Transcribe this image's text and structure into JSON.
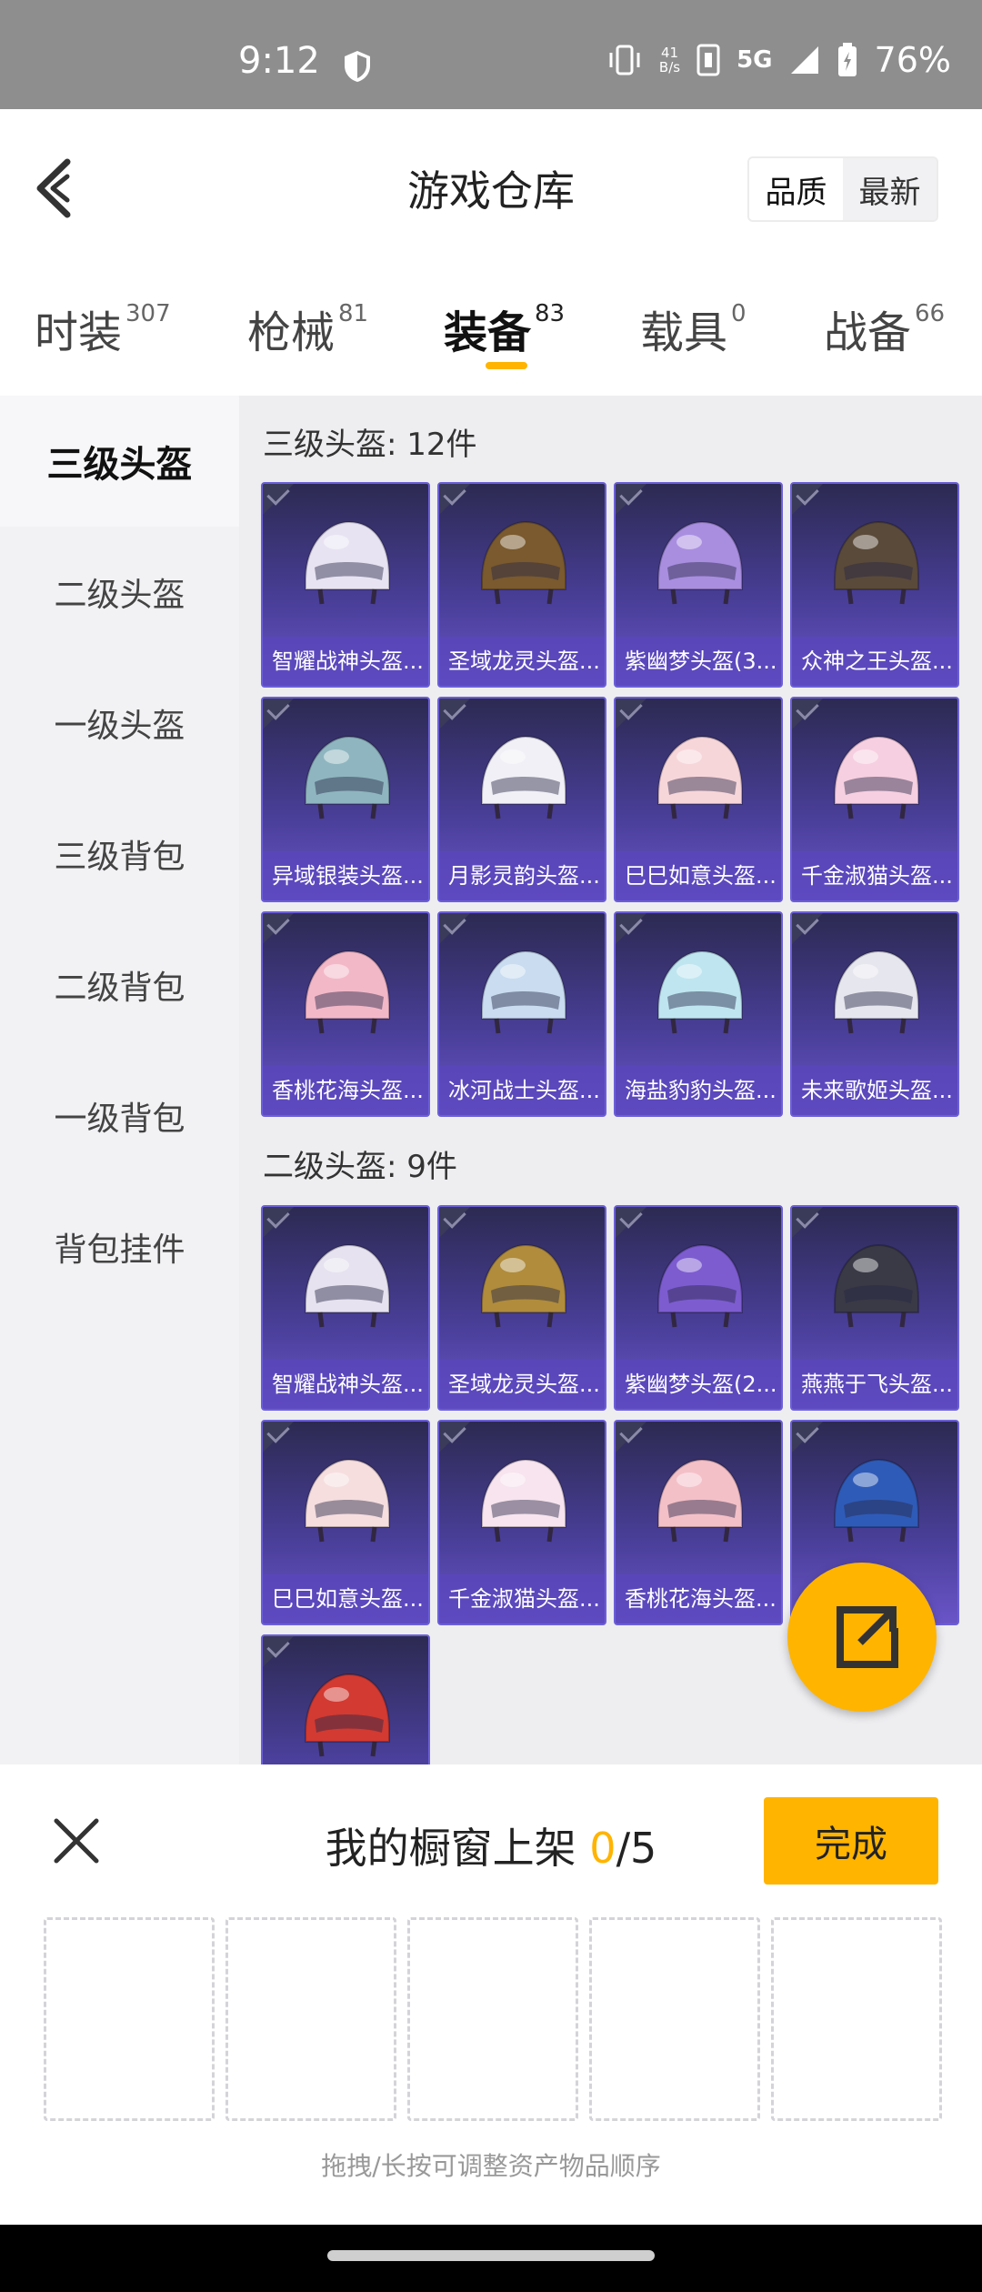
{
  "status": {
    "time": "9:12",
    "net_speed_value": "41",
    "net_speed_unit": "B/s",
    "network": "5G",
    "battery": "76%"
  },
  "header": {
    "title": "游戏仓库",
    "sort_quality": "品质",
    "sort_newest": "最新"
  },
  "tabs": [
    {
      "label": "时装",
      "count": "307"
    },
    {
      "label": "枪械",
      "count": "81"
    },
    {
      "label": "装备",
      "count": "83"
    },
    {
      "label": "载具",
      "count": "0"
    },
    {
      "label": "战备",
      "count": "66"
    }
  ],
  "sidebar": {
    "items": [
      "三级头盔",
      "二级头盔",
      "一级头盔",
      "三级背包",
      "二级背包",
      "一级背包",
      "背包挂件"
    ]
  },
  "sections": [
    {
      "title": "三级头盔: 12件",
      "items": [
        {
          "name": "智耀战神头盔...",
          "color": "#e8e3f2"
        },
        {
          "name": "圣域龙灵头盔...",
          "color": "#7a5a2e"
        },
        {
          "name": "紫幽梦头盔(3...",
          "color": "#a98ee0"
        },
        {
          "name": "众神之王头盔...",
          "color": "#5a4a3a"
        },
        {
          "name": "异域银装头盔...",
          "color": "#8fb6c0"
        },
        {
          "name": "月影灵韵头盔...",
          "color": "#f0f0f6"
        },
        {
          "name": "巳巳如意头盔...",
          "color": "#f7d6da"
        },
        {
          "name": "千金淑猫头盔...",
          "color": "#f6cfe0"
        },
        {
          "name": "香桃花海头盔...",
          "color": "#f3b8c8"
        },
        {
          "name": "冰河战士头盔...",
          "color": "#c9dcf0"
        },
        {
          "name": "海盐豹豹头盔...",
          "color": "#bfe6f0"
        },
        {
          "name": "未来歌姬头盔...",
          "color": "#e6e6ee"
        }
      ]
    },
    {
      "title": "二级头盔: 9件",
      "items": [
        {
          "name": "智耀战神头盔...",
          "color": "#e6e2ef"
        },
        {
          "name": "圣域龙灵头盔...",
          "color": "#b08c3c"
        },
        {
          "name": "紫幽梦头盔(2...",
          "color": "#7d5cd0"
        },
        {
          "name": "燕燕于飞头盔...",
          "color": "#3a3a46"
        },
        {
          "name": "巳巳如意头盔...",
          "color": "#f6dedf"
        },
        {
          "name": "千金淑猫头盔...",
          "color": "#f7e4ee"
        },
        {
          "name": "香桃花海头盔...",
          "color": "#f4c0c8"
        },
        {
          "name": "",
          "color": "#2f5bb8"
        },
        {
          "name": "",
          "color": "#d23a32"
        }
      ]
    }
  ],
  "sheet": {
    "title_prefix": "我的橱窗上架",
    "count": "0",
    "total": "/5",
    "done": "完成",
    "hint": "拖拽/长按可调整资产物品顺序"
  },
  "colors": {
    "accent": "#ffb400",
    "card_bg": "#4a3f9a"
  }
}
